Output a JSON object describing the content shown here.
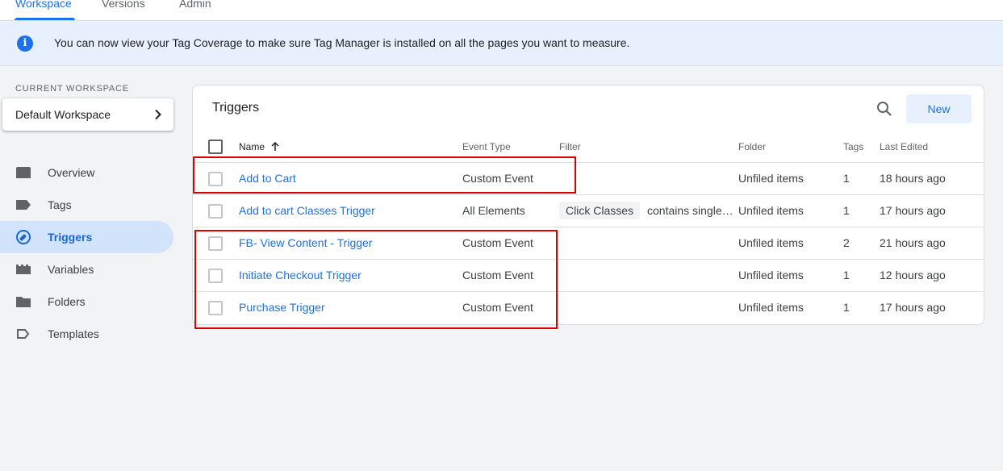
{
  "top_tabs": [
    {
      "label": "Workspace",
      "active": true
    },
    {
      "label": "Versions",
      "active": false
    },
    {
      "label": "Admin",
      "active": false
    }
  ],
  "banner": {
    "icon": "info-icon",
    "message": "You can now view your Tag Coverage to make sure Tag Manager is installed on all the pages you want to measure."
  },
  "sidebar": {
    "workspace_label": "CURRENT WORKSPACE",
    "workspace_name": "Default Workspace",
    "items": [
      {
        "label": "Overview",
        "icon": "overview-icon",
        "active": false
      },
      {
        "label": "Tags",
        "icon": "tag-icon",
        "active": false
      },
      {
        "label": "Triggers",
        "icon": "triggers-icon",
        "active": true
      },
      {
        "label": "Variables",
        "icon": "variables-icon",
        "active": false
      },
      {
        "label": "Folders",
        "icon": "folder-icon",
        "active": false
      },
      {
        "label": "Templates",
        "icon": "templates-icon",
        "active": false
      }
    ]
  },
  "triggers": {
    "title": "Triggers",
    "new_label": "New",
    "columns": {
      "name": "Name",
      "event_type": "Event Type",
      "filter": "Filter",
      "folder": "Folder",
      "tags": "Tags",
      "last_edited": "Last Edited"
    },
    "rows": [
      {
        "name": "Add to Cart",
        "event_type": "Custom Event",
        "filter_chip": "",
        "filter_text": "",
        "folder": "Unfiled items",
        "tags": "1",
        "last_edited": "18 hours ago"
      },
      {
        "name": "Add to cart Classes Trigger",
        "event_type": "All Elements",
        "filter_chip": "Click Classes",
        "filter_text": "contains single…",
        "folder": "Unfiled items",
        "tags": "1",
        "last_edited": "17 hours ago"
      },
      {
        "name": "FB- View Content - Trigger",
        "event_type": "Custom Event",
        "filter_chip": "",
        "filter_text": "",
        "folder": "Unfiled items",
        "tags": "2",
        "last_edited": "21 hours ago"
      },
      {
        "name": "Initiate Checkout Trigger",
        "event_type": "Custom Event",
        "filter_chip": "",
        "filter_text": "",
        "folder": "Unfiled items",
        "tags": "1",
        "last_edited": "12 hours ago"
      },
      {
        "name": "Purchase Trigger",
        "event_type": "Custom Event",
        "filter_chip": "",
        "filter_text": "",
        "folder": "Unfiled items",
        "tags": "1",
        "last_edited": "17 hours ago"
      }
    ]
  },
  "colors": {
    "accent": "#1a73e8",
    "annotation": "#e00000",
    "active_nav_bg": "#d2e3fc",
    "banner_bg": "#e8f0fe"
  }
}
